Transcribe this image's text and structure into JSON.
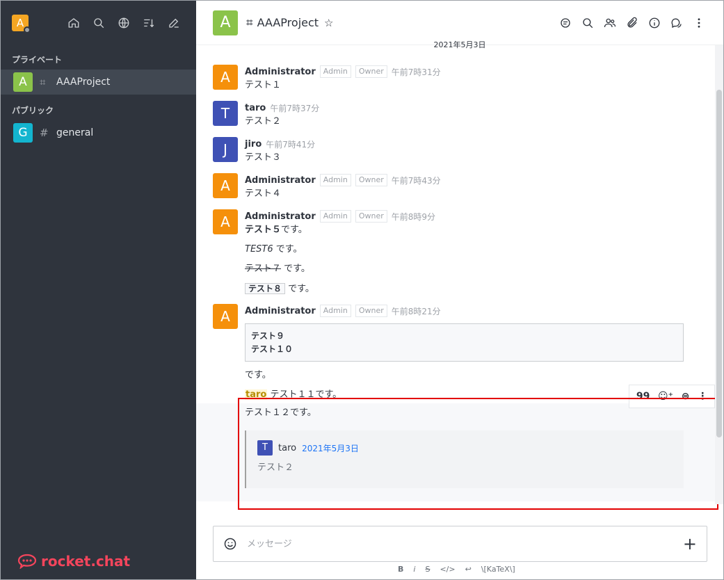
{
  "sidebar": {
    "user_initial": "A",
    "sections": [
      {
        "title": "プライベート",
        "rooms": [
          {
            "initial": "A",
            "name": "AAAProject",
            "color": "#8bc34a",
            "hash": "⌗"
          }
        ]
      },
      {
        "title": "パブリック",
        "rooms": [
          {
            "initial": "G",
            "name": "general",
            "color": "#13b5cf",
            "hash": "#"
          }
        ]
      }
    ],
    "logo": "rocket.chat"
  },
  "header": {
    "room_initial": "A",
    "room_hash": "⌗",
    "room_name": "AAAProject",
    "star": "☆"
  },
  "date_divider": "2021年5月3日",
  "messages": [
    {
      "initial": "A",
      "user": "Administrator",
      "roles": [
        "Admin",
        "Owner"
      ],
      "time": "午前7時31分",
      "text": "テスト１",
      "color": "#f5900b"
    },
    {
      "initial": "T",
      "user": "taro",
      "time": "午前7時37分",
      "text": "テスト２",
      "color": "#3f51b5"
    },
    {
      "initial": "J",
      "user": "jiro",
      "time": "午前7時41分",
      "text": "テスト３",
      "color": "#3f51b5"
    },
    {
      "initial": "A",
      "user": "Administrator",
      "roles": [
        "Admin",
        "Owner"
      ],
      "time": "午前7時43分",
      "text": "テスト４",
      "color": "#f5900b"
    },
    {
      "initial": "A",
      "user": "Administrator",
      "roles": [
        "Admin",
        "Owner"
      ],
      "time": "午前8時9分",
      "color": "#f5900b",
      "lines": {
        "bold": "テスト５",
        "bold_suffix": "です。",
        "italic": "TEST6",
        "italic_suffix": " です。",
        "strike": "テスト７",
        "strike_suffix": " です。",
        "code": "テスト８",
        "code_suffix": " です。"
      }
    },
    {
      "initial": "A",
      "user": "Administrator",
      "roles": [
        "Admin",
        "Owner"
      ],
      "time": "午前8時21分",
      "color": "#f5900b",
      "code_lines": [
        "テスト９",
        "テスト１０"
      ],
      "after_code": "です。",
      "mention": "taro",
      "mention_text": "テスト１１です。",
      "text12": "テスト１２です。"
    }
  ],
  "quote": {
    "initial": "T",
    "user": "taro",
    "date": "2021年5月3日",
    "text": "テスト２"
  },
  "actions": [
    "99",
    "☺⁺",
    "⊜",
    "⋮"
  ],
  "composer": {
    "placeholder": "メッセージ",
    "plus": "+"
  },
  "format_bar": [
    "B",
    "i",
    "S",
    "</>",
    "↩",
    "\\[KaTeX\\]"
  ]
}
